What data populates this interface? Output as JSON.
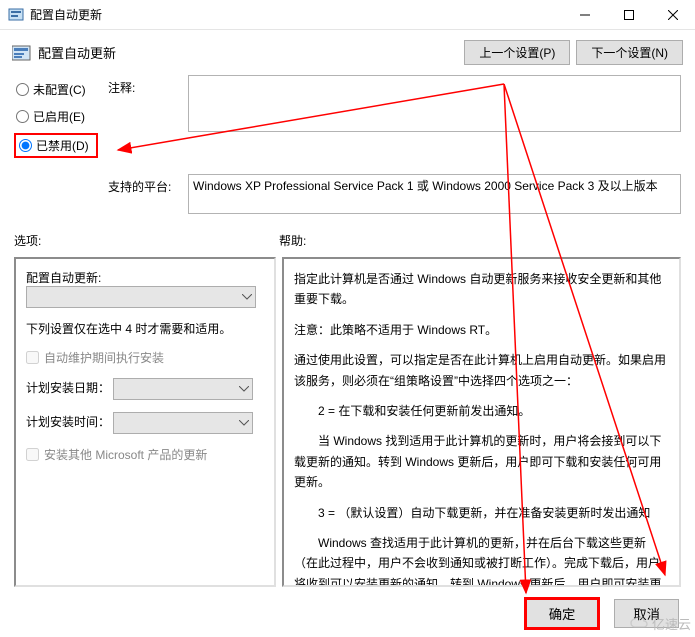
{
  "window": {
    "title": "配置自动更新"
  },
  "header": {
    "title": "配置自动更新",
    "prev_btn": "上一个设置(P)",
    "next_btn": "下一个设置(N)"
  },
  "radio": {
    "not_configured": "未配置(C)",
    "enabled": "已启用(E)",
    "disabled": "已禁用(D)",
    "selected": "disabled"
  },
  "comment": {
    "label": "注释:"
  },
  "platform": {
    "label": "支持的平台:",
    "text": "Windows XP Professional Service Pack 1 或 Windows 2000 Service Pack 3 及以上版本"
  },
  "sections": {
    "options": "选项:",
    "help": "帮助:"
  },
  "options": {
    "configure": "配置自动更新:",
    "note": "下列设置仅在选中 4 时才需要和适用。",
    "auto_maint": "自动维护期间执行安装",
    "install_day": "计划安装日期：",
    "install_time": "计划安装时间：",
    "other_products": "安装其他 Microsoft 产品的更新"
  },
  "help": {
    "p1": "指定此计算机是否通过 Windows 自动更新服务来接收安全更新和其他重要下载。",
    "p2": "注意：此策略不适用于 Windows RT。",
    "p3": "通过使用此设置，可以指定是否在此计算机上启用自动更新。如果启用该服务，则必须在“组策略设置”中选择四个选项之一：",
    "p4": "2 = 在下载和安装任何更新前发出通知。",
    "p5": "当 Windows 找到适用于此计算机的更新时，用户将会接到可以下载更新的通知。转到 Windows 更新后，用户即可下载和安装任何可用更新。",
    "p6": "3 = （默认设置）自动下载更新，并在准备安装更新时发出通知",
    "p7": "Windows 查找适用于此计算机的更新，并在后台下载这些更新（在此过程中，用户不会收到通知或被打断工作）。完成下载后，用户将收到可以安装更新的通知。转到 Windows 更新后，用户即可安装更新。"
  },
  "footer": {
    "ok": "确定",
    "cancel": "取消"
  },
  "watermark": "亿速云"
}
